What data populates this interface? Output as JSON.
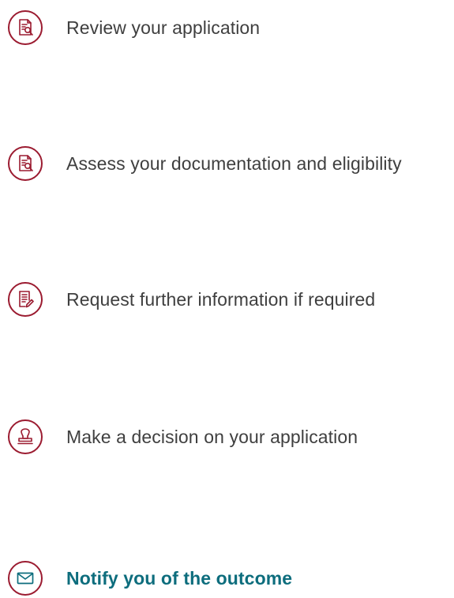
{
  "steps": [
    {
      "label": "Review your application",
      "icon": "document-search-icon"
    },
    {
      "label": "Assess your documentation and eligibility",
      "icon": "document-search-icon"
    },
    {
      "label": "Request further information if required",
      "icon": "document-edit-icon"
    },
    {
      "label": "Make a decision on your application",
      "icon": "stamp-icon"
    },
    {
      "label": "Notify you of the outcome",
      "icon": "envelope-icon"
    }
  ],
  "colors": {
    "icon": "#9b1b30",
    "text": "#3f3f3f",
    "highlight": "#0d6d7d"
  }
}
